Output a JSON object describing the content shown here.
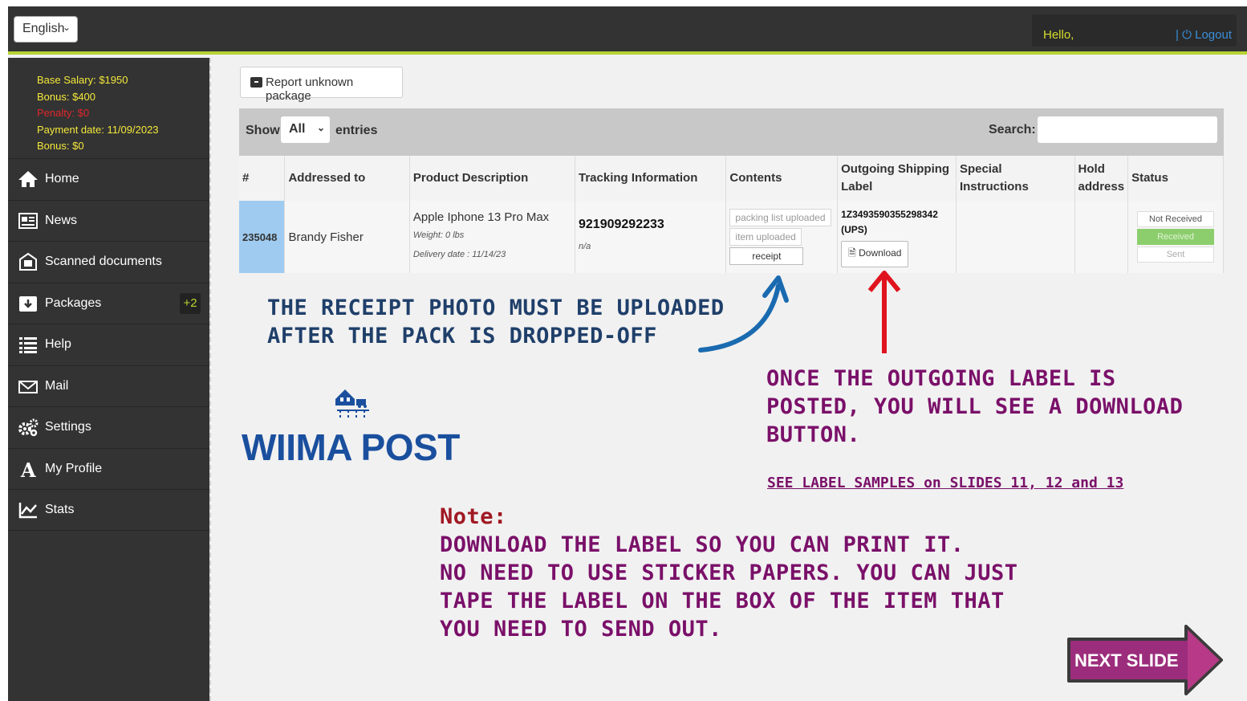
{
  "topbar": {
    "language": "English",
    "hello": "Hello,",
    "logout": "Logout"
  },
  "earnings": {
    "base_salary": "Base Salary: $1950",
    "bonus": "Bonus: $400",
    "penalty": "Penalty: $0",
    "payment_date": "Payment date: 11/09/2023",
    "bonus2": "Bonus: $0"
  },
  "sidebar": {
    "items": [
      {
        "label": "Home",
        "icon": "home-icon"
      },
      {
        "label": "News",
        "icon": "news-icon"
      },
      {
        "label": "Scanned documents",
        "icon": "scanned-documents-icon"
      },
      {
        "label": "Packages",
        "icon": "packages-icon",
        "badge": "+2"
      },
      {
        "label": "Help",
        "icon": "list-icon"
      },
      {
        "label": "Mail",
        "icon": "mail-icon"
      },
      {
        "label": "Settings",
        "icon": "gears-icon"
      },
      {
        "label": "My Profile",
        "icon": "profile-icon"
      },
      {
        "label": "Stats",
        "icon": "stats-icon"
      }
    ]
  },
  "main": {
    "report_button": "Report unknown package",
    "show_label": "Show",
    "entries_value": "All",
    "entries_label": "entries",
    "search_label": "Search:",
    "search_value": ""
  },
  "table": {
    "headers": [
      "#",
      "Addressed to",
      "Product Description",
      "Tracking Information",
      "Contents",
      "Outgoing Shipping Label",
      "Special Instructions",
      "Hold address",
      "Status"
    ],
    "row": {
      "id": "235048",
      "addressed_to": "Brandy Fisher",
      "product": "Apple Iphone 13 Pro Max",
      "weight": "Weight: 0 lbs",
      "delivery": "Delivery date : 11/14/23",
      "tracking": "921909292233",
      "tracking_sub": "n/a",
      "contents": [
        "packing list uploaded",
        "item uploaded",
        "receipt"
      ],
      "label_number": "1Z3493590355298342",
      "label_carrier": "(UPS)",
      "download": "Download",
      "special": "",
      "hold": "",
      "status": [
        "Not Received",
        "Received",
        "Sent"
      ]
    }
  },
  "annotations": {
    "receipt_note": "THE RECEIPT PHOTO MUST BE UPLOADED\nAFTER THE PACK IS DROPPED-OFF",
    "label_note": "ONCE THE OUTGOING LABEL IS\nPOSTED, YOU WILL SEE A DOWNLOAD\nBUTTON.",
    "samples_link": "SEE LABEL SAMPLES on SLIDES 11, 12 and 13",
    "note_title": "Note:",
    "note_body": "DOWNLOAD THE LABEL SO YOU CAN PRINT IT.\nNO NEED TO USE STICKER PAPERS. YOU CAN JUST\nTAPE THE LABEL ON THE BOX OF THE ITEM THAT\nYOU NEED TO SEND OUT."
  },
  "logo": "WIIMA POST",
  "next_button": "NEXT SLIDE",
  "colors": {
    "accent_green": "#b7d334",
    "sidebar_bg": "#333333",
    "salary_text": "#f4e83a",
    "annotation_blue": "#1f3f6a",
    "annotation_purple": "#7a1069",
    "next_button": "#9c2d7c"
  }
}
